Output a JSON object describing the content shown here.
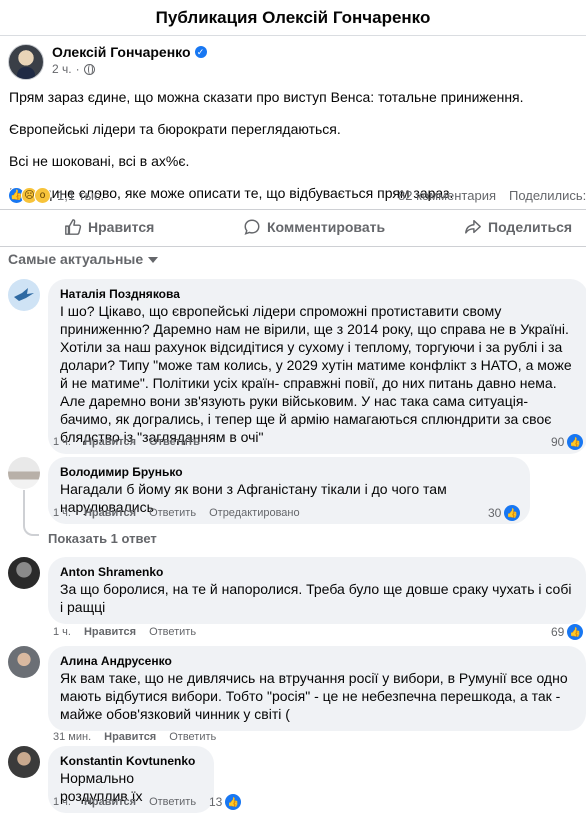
{
  "header": {
    "title": "Публикация Олексій Гончаренко"
  },
  "post": {
    "author": "Олексій Гончаренко",
    "time": "2 ч.",
    "paragraphs": [
      "Прям зараз єдине, що можна сказати про виступ Венса: тотальне приниження.",
      "Європейські лідери та бюрократи переглядаються.",
      "Всі не шоковані, всі в ах%є.",
      "І це єдине слово, яке може описати те, що відбувається прям зараз."
    ],
    "reactions_count": "1,1 тыс.",
    "comments_count": "82 комментария",
    "shares_label": "Поделились:",
    "reaction_icons": [
      "like-reaction-icon",
      "sad-reaction-icon",
      "wow-reaction-icon"
    ]
  },
  "actions": {
    "like": "Нравится",
    "comment": "Комментировать",
    "share": "Поделиться"
  },
  "sort": {
    "label": "Самые актуальные"
  },
  "comments": [
    {
      "author": "Наталія Позднякова",
      "text": "І шо? Цікаво, що європейські лідери спроможні протиставити свому приниженню? Даремно нам не вірили, ще з 2014 року, що справа не в Україні. Хотіли за наш рахунок відсидітися у сухому і теплому, торгуючи і за рублі і за долари? Типу \"може там колись, у 2029 хутін матиме конфлікт з НАТО, а може й не матиме\". Політики усіх країн- справжні повії, до них питань давно нема. Але даремно вони зв'язують руки військовим. У нас така сама ситуація- бачимо, як догрались, і тепер ще й армію намагаються сплюндрити за своє блядство із \"загляданням в очі\"",
      "time": "1 ч.",
      "like": "Нравится",
      "reply": "Ответить",
      "likes": "90"
    },
    {
      "author": "Володимир Брунько",
      "text": "Нагадали б йому як вони з Афганістану тікали і до чого там нарулювались",
      "time": "1 ч.",
      "like": "Нравится",
      "reply": "Ответить",
      "edited": "Отредактировано",
      "likes": "30",
      "show_replies": "Показать 1 ответ"
    },
    {
      "author": "Anton Shramenko",
      "text": "За що боролися, на те й напоролися. Треба було ще довше сраку чухать і собі і ращці",
      "time": "1 ч.",
      "like": "Нравится",
      "reply": "Ответить",
      "likes": "69"
    },
    {
      "author": "Алина Андрусенко",
      "text": "Як вам таке, що не дивлячись на втручання росії у вибори, в Румунії все одно мають відбутися вибори. Тобто \"росія\" - це не небезпечна перешкода, а так - майже обов'язковий чинник у світі (",
      "time": "31 мин.",
      "like": "Нравится",
      "reply": "Ответить"
    },
    {
      "author": "Konstantin Kovtunenko",
      "text": "Нормально роздуплив їх",
      "time": "1 ч.",
      "like": "Нравится",
      "reply": "Ответить",
      "likes": "13"
    }
  ],
  "colors": {
    "accent": "#1877f2",
    "muted": "#65676b",
    "bubble": "#f0f2f5"
  }
}
